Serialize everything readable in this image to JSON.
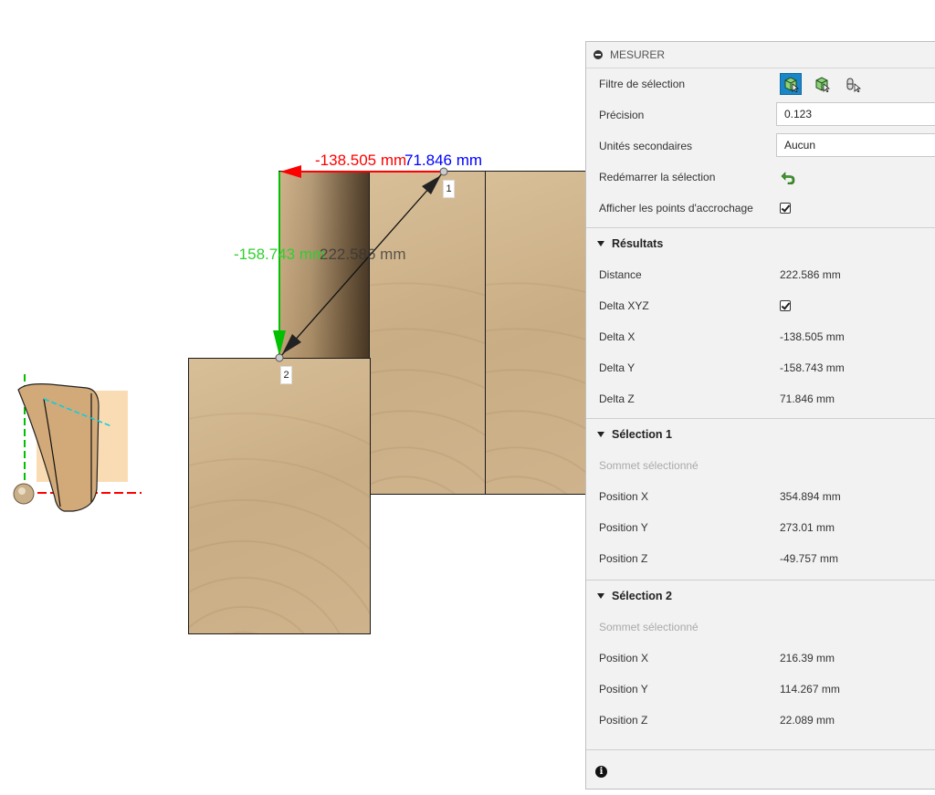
{
  "viewport": {
    "dimensions": {
      "delta_x": "-138.505 mm",
      "delta_z": "71.846 mm",
      "delta_y": "-158.743 mm",
      "distance": "222.586 mm"
    },
    "points": [
      "1",
      "2"
    ],
    "colors": {
      "x_axis": "#ff0000",
      "y_axis": "#00c000",
      "z_axis": "#0000ff",
      "distance": "#555555"
    }
  },
  "panel": {
    "title": "MESURER",
    "settings": {
      "selection_filter": {
        "label": "Filtre de sélection"
      },
      "precision": {
        "label": "Précision",
        "value": "0.123"
      },
      "secondary_units": {
        "label": "Unités secondaires",
        "value": "Aucun"
      },
      "restart_selection": {
        "label": "Redémarrer la sélection"
      },
      "show_snap_points": {
        "label": "Afficher les points d'accrochage"
      }
    },
    "results": {
      "title": "Résultats",
      "distance": {
        "label": "Distance",
        "value": "222.586 mm"
      },
      "delta_xyz": {
        "label": "Delta XYZ"
      },
      "delta_x": {
        "label": "Delta X",
        "value": "-138.505 mm"
      },
      "delta_y": {
        "label": "Delta Y",
        "value": "-158.743 mm"
      },
      "delta_z": {
        "label": "Delta Z",
        "value": "71.846 mm"
      }
    },
    "selection1": {
      "title": "Sélection 1",
      "subtitle": "Sommet sélectionné",
      "position_x": {
        "label": "Position X",
        "value": "354.894 mm"
      },
      "position_y": {
        "label": "Position Y",
        "value": "273.01 mm"
      },
      "position_z": {
        "label": "Position Z",
        "value": "-49.757 mm"
      }
    },
    "selection2": {
      "title": "Sélection 2",
      "subtitle": "Sommet sélectionné",
      "position_x": {
        "label": "Position X",
        "value": "216.39 mm"
      },
      "position_y": {
        "label": "Position Y",
        "value": "114.267 mm"
      },
      "position_z": {
        "label": "Position Z",
        "value": "22.089 mm"
      }
    },
    "accent_color": "#1a86c8"
  }
}
